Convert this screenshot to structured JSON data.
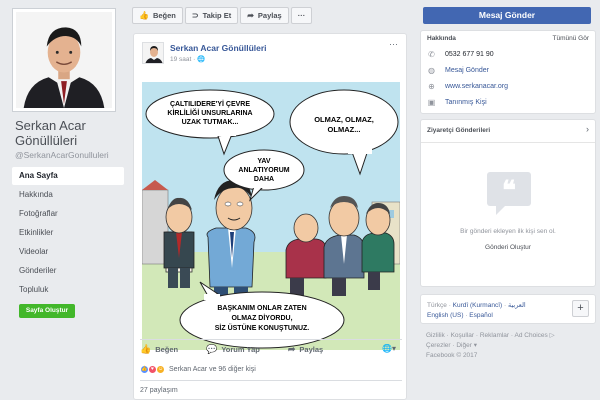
{
  "page": {
    "name": "Serkan Acar Gönüllüleri",
    "handle": "@SerkanAcarGonulluleri"
  },
  "nav": [
    {
      "label": "Ana Sayfa",
      "active": true
    },
    {
      "label": "Hakkında"
    },
    {
      "label": "Fotoğraflar"
    },
    {
      "label": "Etkinlikler"
    },
    {
      "label": "Videolar"
    },
    {
      "label": "Gönderiler"
    },
    {
      "label": "Topluluk"
    }
  ],
  "create_page": "Sayfa Oluştur",
  "actions": {
    "like": "Beğen",
    "follow": "Takip Et",
    "share": "Paylaş",
    "more": "···"
  },
  "post": {
    "author": "Serkan Acar Gönüllüleri",
    "time": "19 saat",
    "menu": "···",
    "bubbles": {
      "b1": [
        "ÇALTILIDERE'Yİ ÇEVRE",
        "KİRLİLİĞİ UNSURLARINA",
        "UZAK TUTMAK..."
      ],
      "b2": [
        "OLMAZ, OLMAZ,",
        "OLMAZ..."
      ],
      "b3": [
        "YAV",
        "ANLATIYORUM",
        "DAHA"
      ],
      "b4": [
        "BAŞKANIM ONLAR ZATEN",
        "OLMAZ DİYORDU,",
        "SİZ ÜSTÜNE KONUŞTUNUZ."
      ]
    },
    "bar": {
      "like": "Beğen",
      "comment": "Yorum Yap",
      "share": "Paylaş"
    },
    "reactions_text": "Serkan Acar ve 96 diğer kişi",
    "shares": "27 paylaşım"
  },
  "right": {
    "message_button": "Mesaj Gönder",
    "about": {
      "title": "Hakkında",
      "see_all": "Tümünü Gör",
      "phone": "0532 677 91 90",
      "message": "Mesaj Gönder",
      "website": "www.serkanacar.org",
      "person": "Tanınmış Kişi"
    },
    "visitor": {
      "title": "Ziyaretçi Gönderileri",
      "empty_text": "Bir gönderi ekleyen ilk kişi sen ol.",
      "create_link": "Gönderi Oluştur"
    },
    "languages": {
      "current": "Türkçe",
      "others": [
        "Kurdî (Kurmancî)",
        "العربية",
        "English (US)",
        "Español"
      ]
    },
    "footer": {
      "links": [
        "Gizlilik",
        "Koşullar",
        "Reklamlar",
        "Ad Choices",
        "Çerezler",
        "Diğer"
      ],
      "copyright": "Facebook © 2017"
    }
  }
}
